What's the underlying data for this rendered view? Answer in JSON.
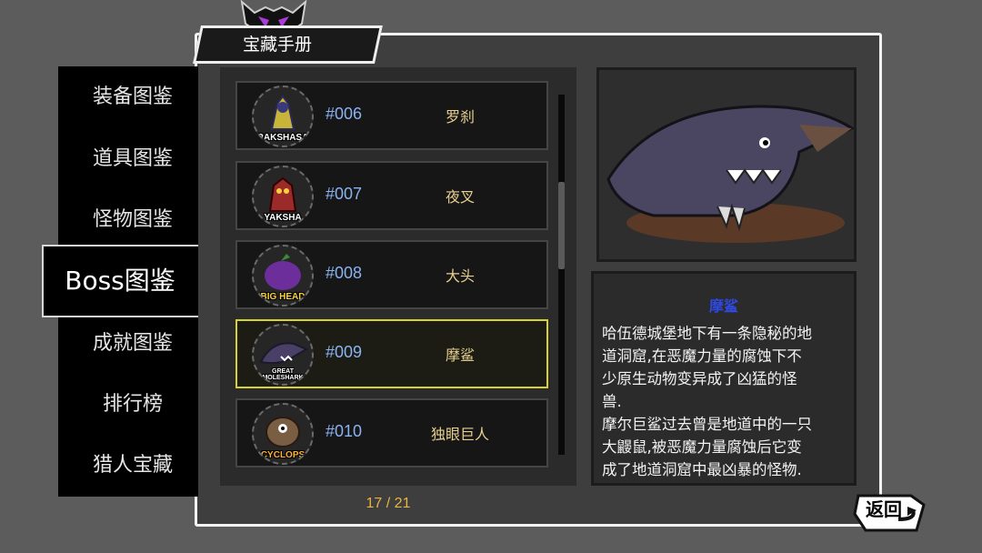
{
  "header": {
    "title": "宝藏手册"
  },
  "nav": {
    "items": [
      {
        "label": "装备图鉴"
      },
      {
        "label": "道具图鉴"
      },
      {
        "label": "怪物图鉴"
      },
      {
        "label": "Boss图鉴"
      },
      {
        "label": "成就图鉴"
      },
      {
        "label": "排行榜"
      },
      {
        "label": "猎人宝藏"
      }
    ],
    "active_index": 3
  },
  "list": {
    "entries": [
      {
        "number": "#006",
        "name": "罗刹",
        "badge_text": "RAKSHASA",
        "badge_color": "#d9c84a"
      },
      {
        "number": "#007",
        "name": "夜叉",
        "badge_text": "YAKSHA",
        "badge_color": "#c0392b"
      },
      {
        "number": "#008",
        "name": "大头",
        "badge_text": "BIG HEAD",
        "badge_color": "#7b3fa8"
      },
      {
        "number": "#009",
        "name": "摩鲨",
        "badge_text": "GREAT MOLESHARK",
        "badge_color": "#4a3f66"
      },
      {
        "number": "#010",
        "name": "独眼巨人",
        "badge_text": "CYCLOPS",
        "badge_color": "#8a6a4a"
      }
    ],
    "selected_index": 3,
    "page": "17 / 21"
  },
  "detail": {
    "name": "摩鲨",
    "description_lines": [
      "哈伍德城堡地下有一条隐秘的地",
      "道洞窟,在恶魔力量的腐蚀下不",
      "少原生动物变异成了凶猛的怪",
      "兽.",
      "摩尔巨鲨过去曾是地道中的一只",
      "大鼹鼠,被恶魔力量腐蚀后它变",
      "成了地道洞窟中最凶暴的怪物."
    ]
  },
  "back_button": {
    "label": "返回"
  },
  "colors": {
    "accent_selected": "#d6d230",
    "number_text": "#8ab3f2",
    "name_text": "#e7cf8e",
    "title_text": "#2f48e0",
    "page_text": "#e8b640"
  }
}
